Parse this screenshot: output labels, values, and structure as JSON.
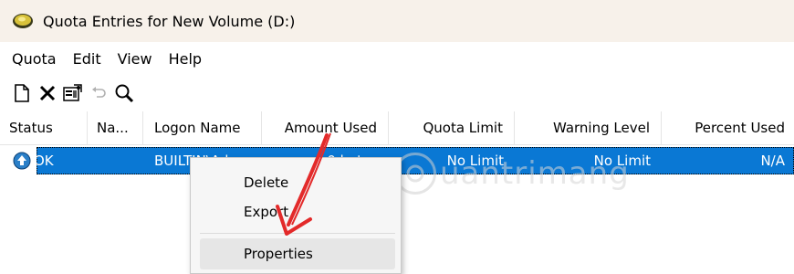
{
  "window": {
    "title": "Quota Entries for New Volume (D:)",
    "icon": "disk-icon"
  },
  "menu": [
    "Quota",
    "Edit",
    "View",
    "Help"
  ],
  "toolbar": [
    {
      "icon": "new-entry-icon"
    },
    {
      "icon": "delete-icon"
    },
    {
      "icon": "properties-icon"
    },
    {
      "icon": "undo-icon"
    },
    {
      "icon": "find-icon"
    }
  ],
  "table": {
    "columns": [
      "Status",
      "Na...",
      "Logon Name",
      "Amount Used",
      "Quota Limit",
      "Warning Level",
      "Percent Used"
    ],
    "rows": [
      {
        "status": "OK",
        "name": "",
        "logon": "BUILTIN\\Ad...",
        "amount": "0 bytes",
        "limit": "No Limit",
        "warning": "No Limit",
        "percent": "N/A",
        "selected": true
      }
    ]
  },
  "context_menu": {
    "items": [
      "Delete",
      "Export",
      "Properties"
    ],
    "highlighted": "Properties"
  },
  "watermark": {
    "text": "uantrimang"
  },
  "colors": {
    "selection": "#0a78d4",
    "arrow": "#e32a2a",
    "titlebar": "#f7f1ea"
  }
}
